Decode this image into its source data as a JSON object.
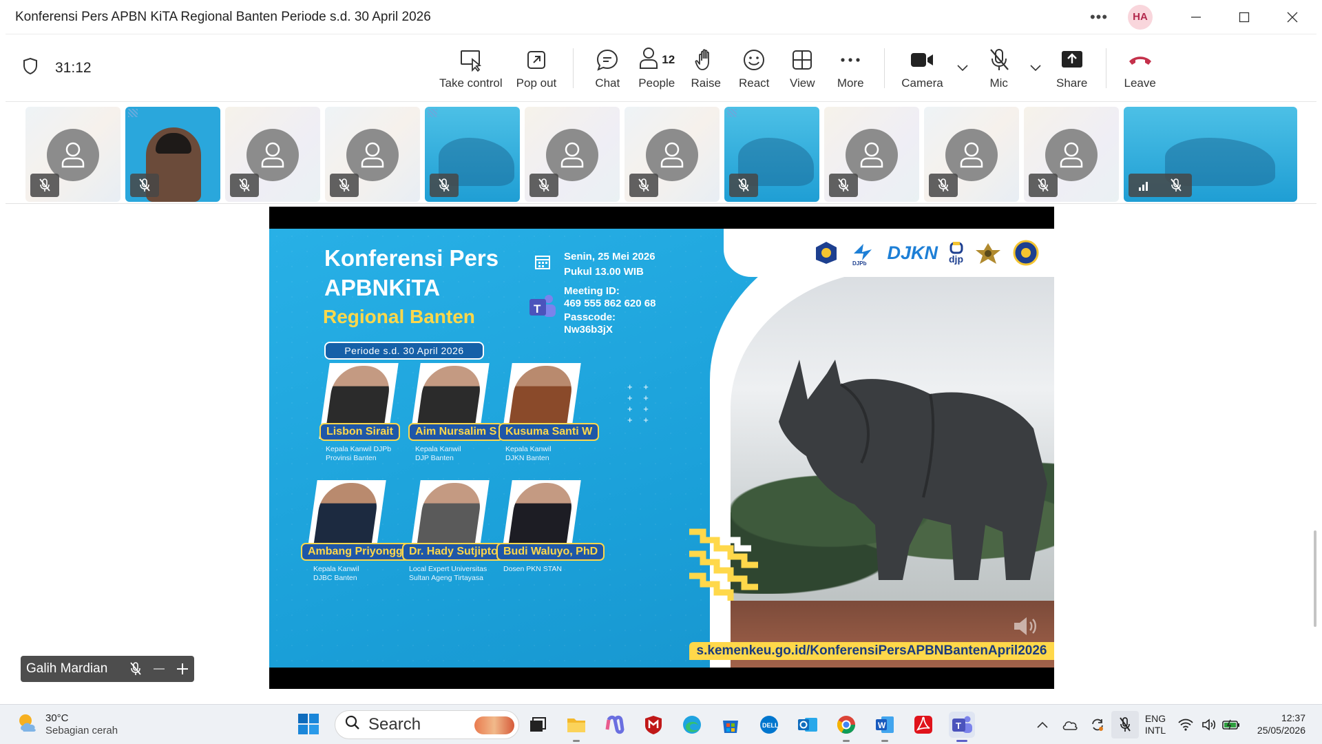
{
  "window": {
    "title": "Konferensi Pers APBN KiTA Regional Banten Periode s.d. 30 April 2026",
    "avatar_initials": "HA"
  },
  "toolbar": {
    "timer": "31:12",
    "take_control": "Take control",
    "pop_out": "Pop out",
    "chat": "Chat",
    "people": "People",
    "people_count": "12",
    "raise": "Raise",
    "react": "React",
    "view": "View",
    "more": "More",
    "camera": "Camera",
    "mic": "Mic",
    "share": "Share",
    "leave": "Leave"
  },
  "slide": {
    "title_line1": "Konferensi Pers",
    "title_line2": "APBNKiTA",
    "title_line3": "Regional Banten",
    "period": "Periode s.d. 30 April 2026",
    "date": "Senin, 25 Mei 2026",
    "time": "Pukul 13.00 WIB",
    "meeting_label": "Meeting ID:",
    "meeting_id": "469 555 862 620 68",
    "passcode_label": "Passcode:",
    "passcode": "Nw36b3jX",
    "logo_djpb": "DJPb",
    "logo_djkn": "DJKN",
    "logo_djp": "djp",
    "speakers": [
      {
        "name": "Lisbon Sirait",
        "role1": "Kepala Kanwil DJPb",
        "role2": "Provinsi Banten"
      },
      {
        "name": "Aim Nursalim S",
        "role1": "Kepala Kanwil",
        "role2": "DJP Banten"
      },
      {
        "name": "Kusuma Santi W",
        "role1": "Kepala Kanwil",
        "role2": "DJKN Banten"
      },
      {
        "name": "Ambang Priyonggo",
        "role1": "Kepala Kanwil",
        "role2": "DJBC Banten"
      },
      {
        "name": "Dr. Hady Sutjipto",
        "role1": "Local Expert Universitas",
        "role2": "Sultan Ageng Tirtayasa"
      },
      {
        "name": "Budi Waluyo, PhD",
        "role1": "Dosen PKN STAN",
        "role2": ""
      }
    ],
    "url": "s.kemenkeu.go.id/KonferensiPersAPBNBantenApril2026"
  },
  "participant_tiles": [
    {
      "type": "avatar"
    },
    {
      "type": "video"
    },
    {
      "type": "avatar"
    },
    {
      "type": "avatar"
    },
    {
      "type": "slide"
    },
    {
      "type": "avatar"
    },
    {
      "type": "avatar"
    },
    {
      "type": "slide"
    },
    {
      "type": "avatar"
    },
    {
      "type": "avatar"
    },
    {
      "type": "avatar"
    },
    {
      "type": "slide-wide"
    }
  ],
  "self_view": {
    "name": "Galih Mardian"
  },
  "taskbar": {
    "temperature": "30°C",
    "weather": "Sebagian cerah",
    "search": "Search",
    "lang1": "ENG",
    "lang2": "INTL",
    "time": "12:37",
    "date": "25/05/2026"
  },
  "colors": {
    "accent_teams": "#5b5fc7",
    "slide_blue": "#1a9fd8",
    "slide_yellow": "#ffd84a",
    "leave_red": "#c4314b"
  }
}
